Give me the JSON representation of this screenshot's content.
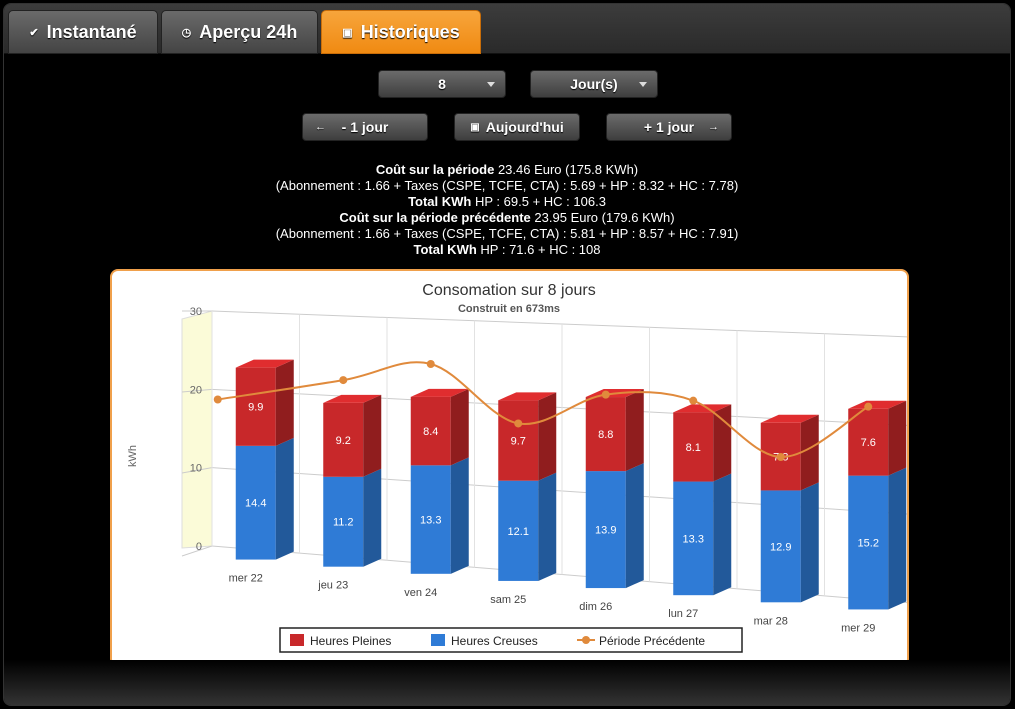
{
  "tabs": [
    {
      "label": "Instantané",
      "icon": "check-icon",
      "active": false
    },
    {
      "label": "Aperçu 24h",
      "icon": "clock-icon",
      "active": false
    },
    {
      "label": "Historiques",
      "icon": "calendar-icon",
      "active": true
    }
  ],
  "controls": {
    "count_value": "8",
    "unit_value": "Jour(s)",
    "prev_label": "- 1 jour",
    "today_label": "Aujourd'hui",
    "next_label": "+ 1 jour"
  },
  "summary": {
    "cost_label": "Coût sur la période",
    "cost_value": "23.46 Euro (175.8 KWh)",
    "cost_detail": "(Abonnement : 1.66 + Taxes (CSPE, TCFE, CTA) : 5.69 + HP : 8.32 + HC : 7.78)",
    "total_label": "Total KWh",
    "total_value": "HP : 69.5 + HC : 106.3",
    "prev_cost_label": "Coût sur la période précédente",
    "prev_cost_value": "23.95 Euro (179.6 KWh)",
    "prev_cost_detail": "(Abonnement : 1.66 + Taxes (CSPE, TCFE, CTA) : 5.81 + HP : 8.57 + HC : 7.91)",
    "prev_total_label": "Total KWh",
    "prev_total_value": "HP : 71.6 + HC : 108"
  },
  "colors": {
    "accent": "#f08a12",
    "hp": "#c8282a",
    "hc": "#2f7bd6",
    "prev": "#e08a3c"
  },
  "chart_data": {
    "type": "bar",
    "stacked": true,
    "three_d": true,
    "title": "Consomation sur 8 jours",
    "subtitle": "Construit en 673ms",
    "ylabel": "kWh",
    "ylim": [
      0,
      30
    ],
    "yticks": [
      0,
      10,
      20,
      30
    ],
    "categories": [
      "mer 22",
      "jeu 23",
      "ven 24",
      "sam 25",
      "dim 26",
      "lun 27",
      "mar 28",
      "mer 29"
    ],
    "series": [
      {
        "name": "Heures Pleines",
        "type": "bar",
        "values": [
          9.9,
          9.2,
          8.4,
          9.7,
          8.8,
          8.1,
          7.8,
          7.6
        ]
      },
      {
        "name": "Heures Creuses",
        "type": "bar",
        "values": [
          14.4,
          11.2,
          13.3,
          12.1,
          13.9,
          13.3,
          12.9,
          15.2
        ]
      },
      {
        "name": "Période Précédente",
        "type": "line",
        "values": [
          19.0,
          22.0,
          24.5,
          17.8,
          21.8,
          21.6,
          15.6,
          21.9
        ]
      }
    ],
    "legend": "bottom-center",
    "grid": true
  }
}
